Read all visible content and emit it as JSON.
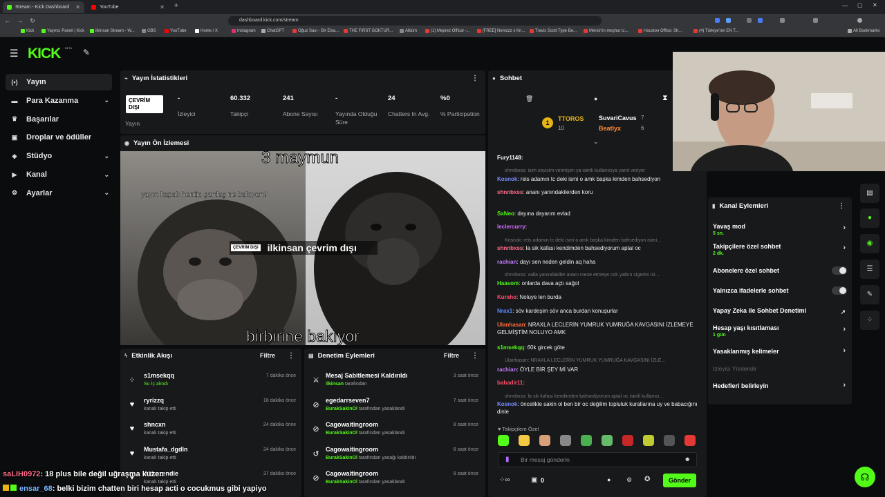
{
  "browser": {
    "tabs": [
      {
        "label": "Stream - Kick Dashboard"
      },
      {
        "label": "YouTube"
      }
    ],
    "url": "dashboard.kick.com/stream",
    "bookmarks": [
      "Kick",
      "Yayıncı Paneli | Kick",
      "ilkinsan Stream - W...",
      "OBS",
      "YouTube",
      "Home / X",
      "Instagram",
      "ChatGPT",
      "Oğuz Sası - Bir Elsa...",
      "THE FIRST GOKTUR...",
      "Albüm",
      "(1) Meprez Offical -...",
      "[FREE] Nemzzz x Kn...",
      "Travis Scott Type Be...",
      "Mersin'in meşhur ci...",
      "Houston Office: Sh...",
      "(4) Türkiye'nin EN T...",
      "All Bookmarks"
    ]
  },
  "header": {
    "logo": "KICK",
    "beta": "BETA"
  },
  "sidebar": {
    "items": [
      {
        "label": "Yayın",
        "icon": "broadcast-icon",
        "active": true
      },
      {
        "label": "Para Kazanma",
        "icon": "money-icon",
        "chevron": true
      },
      {
        "label": "Başarılar",
        "icon": "trophy-icon"
      },
      {
        "label": "Droplar ve ödüller",
        "icon": "gift-icon"
      },
      {
        "label": "Stüdyo",
        "icon": "studio-icon",
        "chevron": true
      },
      {
        "label": "Kanal",
        "icon": "channel-icon",
        "chevron": true
      },
      {
        "label": "Ayarlar",
        "icon": "gear-icon",
        "chevron": true
      }
    ]
  },
  "stats": {
    "title": "Yayın İstatistikleri",
    "status_badge": "ÇEVRİM DIŞI",
    "status_label": "Yayın",
    "items": [
      {
        "value": "-",
        "label": "İzleyici"
      },
      {
        "value": "60.332",
        "label": "Takipçi"
      },
      {
        "value": "241",
        "label": "Abone Sayısı"
      },
      {
        "value": "-",
        "label": "Yayında Olduğu Süre"
      },
      {
        "value": "24",
        "label": "Chatters In Avg."
      },
      {
        "value": "%0",
        "label": "% Participation"
      }
    ]
  },
  "preview": {
    "title": "Yayın Ön İzlemesi",
    "caption_top": "3 maymun",
    "caption_mid": "yayın kapalı henüz gardaş ne bakıyon?",
    "caption_bottom": "birbirine bakıyor",
    "offline_badge": "ÇEVRİM DIŞI",
    "offline_text": "ilkinsan çevrim dışı"
  },
  "activity": {
    "title": "Etkinlik Akışı",
    "filter": "Filtre",
    "items": [
      {
        "name": "s1msekqq",
        "detail": "Su İç alındı",
        "time": "7 dakika önce",
        "icon": "reward-icon"
      },
      {
        "name": "ryrizzq",
        "detail": "kanalı takip etti",
        "time": "18 dakika önce",
        "icon": "heart-icon"
      },
      {
        "name": "shncxn",
        "detail": "kanalı takip etti",
        "time": "24 dakika önce",
        "icon": "heart-icon"
      },
      {
        "name": "Mustafa_dgdln",
        "detail": "kanalı takip etti",
        "time": "24 dakika önce",
        "icon": "heart-icon"
      },
      {
        "name": "Alikuzendie",
        "detail": "kanalı takip etti",
        "time": "37 dakika önce",
        "icon": "heart-icon"
      }
    ]
  },
  "moderation": {
    "title": "Denetim Eylemleri",
    "filter": "Filtre",
    "items": [
      {
        "name": "Mesaj Sabitlemesi Kaldırıldı",
        "by": "ilkinsan",
        "suffix": "tarafından",
        "time": "3 saat önce",
        "icon": "unpin-icon"
      },
      {
        "name": "egedarrseven7",
        "by": "BurakSakinOl",
        "suffix": "tarafından yasaklandı",
        "time": "7 saat önce",
        "icon": "ban-icon"
      },
      {
        "name": "Cagowaitingroom",
        "by": "BurakSakinOl",
        "suffix": "tarafından yasaklandı",
        "time": "8 saat önce",
        "icon": "ban-icon"
      },
      {
        "name": "Cagowaitingroom",
        "by": "BurakSakinOl",
        "suffix": "tarafından yasağı kaldırıldı",
        "time": "8 saat önce",
        "icon": "unban-icon"
      },
      {
        "name": "Cagowaitingroom",
        "by": "BurakSakinOl",
        "suffix": "tarafından yasaklandı",
        "time": "8 saat önce",
        "icon": "ban-icon"
      }
    ]
  },
  "chat": {
    "title": "Sohbet",
    "leaders": [
      {
        "name": "TTOROS",
        "count": "10"
      },
      {
        "name": "SuvariCavus",
        "count": "7"
      },
      {
        "name": "Beatlyx",
        "count": "6"
      }
    ],
    "messages": [
      {
        "user": "Fury1148:",
        "text": "",
        "color": "#ffffff",
        "sys": false
      },
      {
        "user": "",
        "text": "shnnbxss: isim soyisim vermişim ya isimli kullanıcıya yanıt veriyor",
        "color": "#777777",
        "sys": true
      },
      {
        "user": "Kosnok",
        "text": ": reis adamın tc deki ismi o amk başka kimden bahsediyon",
        "color": "#7a8cff",
        "sys": false
      },
      {
        "user": "shnnbxss",
        "text": ": ananı yanındakilerden koru",
        "color": "#ff6b8a",
        "sys": false
      },
      {
        "user": "SxNeo",
        "text": ": dayına dayarım evlad",
        "color": "#53fc18",
        "sys": false
      },
      {
        "user": "leclercurry",
        "text": ":",
        "color": "#d86bff",
        "sys": false
      },
      {
        "user": "",
        "text": "Kosnok: reis adamın tc deki ismi o amk başka kimden bahsediyon isimi...",
        "color": "#777777",
        "sys": true
      },
      {
        "user": "shnnbxss",
        "text": ": la sik kafası kendimden bahsediyorum aptal oc",
        "color": "#ff6b8a",
        "sys": false
      },
      {
        "user": "rachian",
        "text": ": dayı sen neden geldin aq haha",
        "color": "#c77dff",
        "sys": false
      },
      {
        "user": "",
        "text": "shnnbxss: valla yanındakiler ananı meze etmeye cok yatkın cigerim isi...",
        "color": "#777777",
        "sys": true
      },
      {
        "user": "Haasom",
        "text": ": onlarda dava açtı sağol",
        "color": "#53fc18",
        "sys": false
      },
      {
        "user": "Kuraho",
        "text": ": Noluye len burda",
        "color": "#ff4d6d",
        "sys": false
      },
      {
        "user": "Nrax1",
        "text": ": söv kardeşim söv anca burdan konuşurlar",
        "color": "#5b8cff",
        "sys": false
      },
      {
        "user": "Ulanhasan",
        "text": ": NRAXLA LECLERİN YUMRUK YUMRUĞA KAVGASINI İZLEMEYE GELMİŞTİM NOLUYO AMK",
        "color": "#ff6b3d",
        "sys": false
      },
      {
        "user": "s1msekqq",
        "text": ": 60k gircek göte",
        "color": "#53fc18",
        "sys": false
      },
      {
        "user": "",
        "text": "Ulanhasan: NRAXLA LECLERİN YUMRUK YUMRUĞA KAVGASINI İZLE...",
        "color": "#777777",
        "sys": true
      },
      {
        "user": "rachian",
        "text": ": ÖYLE BİR ŞEY Mİ VAR",
        "color": "#c77dff",
        "sys": false
      },
      {
        "user": "bahadir11:",
        "text": "",
        "color": "#ff4d6d",
        "sys": false
      },
      {
        "user": "",
        "text": "shnnbxss: la sik kafası kendimden bahsediyorum aptal oc isimli kullanıcı...",
        "color": "#777777",
        "sys": true
      },
      {
        "user": "Kosnok",
        "text": ": öncelikle sakin ol ben bir oc değilim topluluk kurallarına uy ve babacığını dinle",
        "color": "#7a8cff",
        "sys": false
      }
    ],
    "followers_only": "Takipçilere Özel",
    "input_placeholder": "Bir mesaj gönderin",
    "points": "0",
    "send_label": "Gönder"
  },
  "channel_actions": {
    "title": "Kanal Eylemleri",
    "items": [
      {
        "label": "Yavaş mod",
        "sub": "5 sn.",
        "control": "arrow"
      },
      {
        "label": "Takipçilere özel sohbet",
        "sub": "2 dk.",
        "control": "arrow"
      },
      {
        "label": "Abonelere özel sohbet",
        "sub": "",
        "control": "toggle"
      },
      {
        "label": "Yalnızca ifadelerle sohbet",
        "sub": "",
        "control": "toggle"
      },
      {
        "label": "Yapay Zeka ile Sohbet Denetimi",
        "sub": "",
        "control": "external"
      },
      {
        "label": "Hesap yaşı kısıtlaması",
        "sub": "1 gün",
        "control": "arrow"
      },
      {
        "label": "Yasaklanmış kelimeler",
        "sub": "",
        "control": "arrow"
      },
      {
        "label": "İzleyici Yönlendir",
        "sub": "",
        "control": "disabled"
      },
      {
        "label": "Hedefleri belirleyin",
        "sub": "",
        "control": "arrow"
      }
    ]
  },
  "overlay_chat": [
    {
      "user": "saLIH0972",
      "text": ": 18 plus bile değil uğraşma kuzen"
    },
    {
      "user": "ensar_68",
      "text": ": belki bizim chatten biri hesap acti o cocukmus gibi yapiyo"
    }
  ],
  "colors": {
    "accent": "#53fc18",
    "panel": "#18191b",
    "bg": "#0b0c0d"
  }
}
